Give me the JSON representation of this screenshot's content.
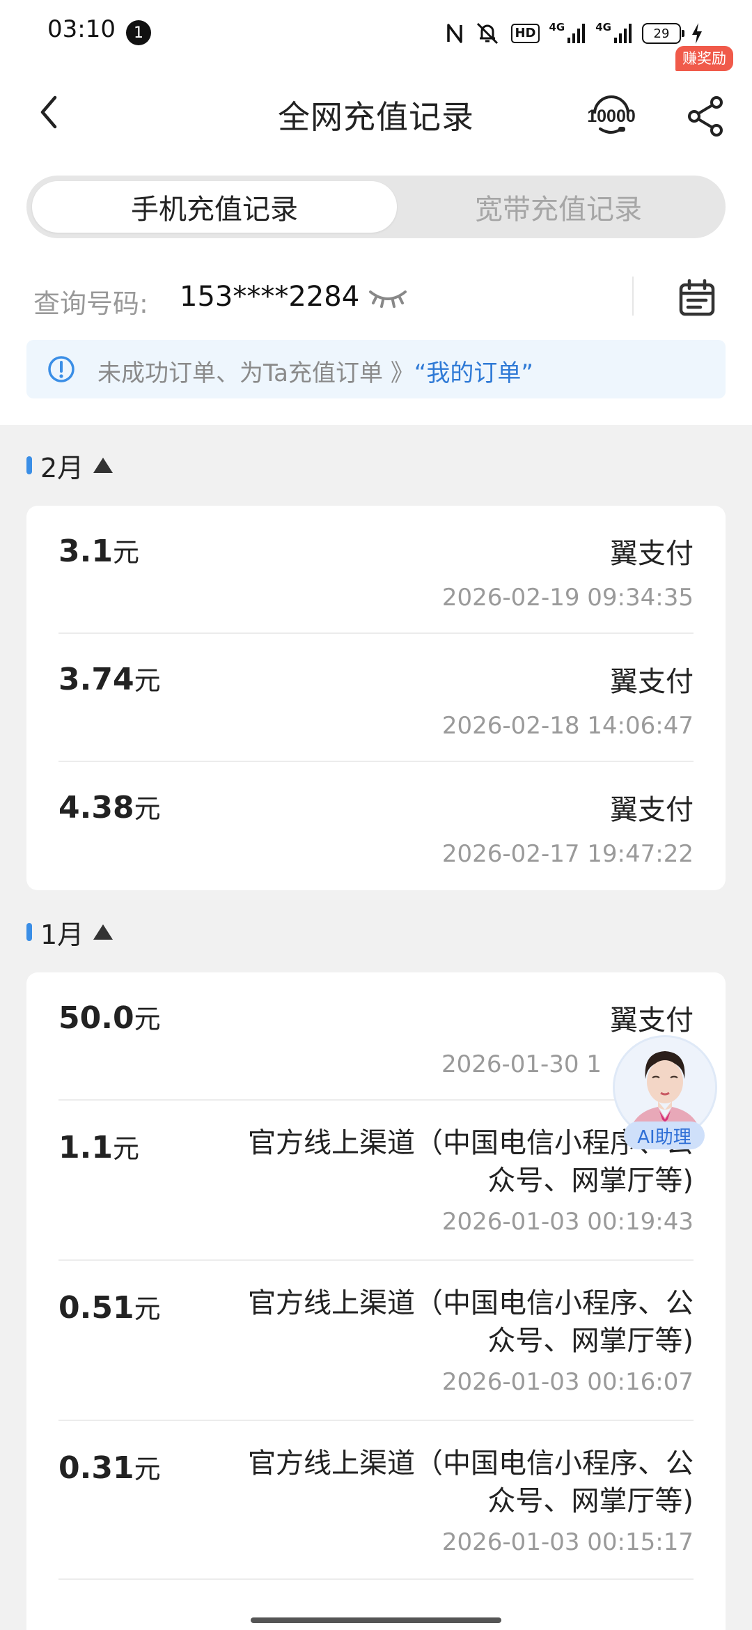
{
  "status_bar": {
    "time": "03:10",
    "notification_count": "1",
    "hd_label": "HD",
    "net1": "4G",
    "net2": "4G",
    "battery": "29"
  },
  "header": {
    "title": "全网充值记录",
    "reward_badge": "赚奖励"
  },
  "tabs": [
    {
      "label": "手机充值记录",
      "active": true
    },
    {
      "label": "宽带充值记录",
      "active": false
    }
  ],
  "query": {
    "label": "查询号码:",
    "number": "153****2284"
  },
  "notice": {
    "text": "未成功订单、为Ta充值订单 》",
    "link": "“我的订单”"
  },
  "months": [
    {
      "label": "2月",
      "records": [
        {
          "amount": "3.1",
          "unit": "元",
          "method": "翼支付",
          "time": "2026-02-19 09:34:35"
        },
        {
          "amount": "3.74",
          "unit": "元",
          "method": "翼支付",
          "time": "2026-02-18 14:06:47"
        },
        {
          "amount": "4.38",
          "unit": "元",
          "method": "翼支付",
          "time": "2026-02-17 19:47:22"
        }
      ]
    },
    {
      "label": "1月",
      "records": [
        {
          "amount": "50.0",
          "unit": "元",
          "method": "翼支付",
          "time": "2026-01-30 1"
        },
        {
          "amount": "1.1",
          "unit": "元",
          "method": "官方线上渠道（中国电信小程序、公众号、网掌厅等)",
          "time": "2026-01-03 00:19:43"
        },
        {
          "amount": "0.51",
          "unit": "元",
          "method": "官方线上渠道（中国电信小程序、公众号、网掌厅等)",
          "time": "2026-01-03 00:16:07"
        },
        {
          "amount": "0.31",
          "unit": "元",
          "method": "官方线上渠道（中国电信小程序、公众号、网掌厅等)",
          "time": "2026-01-03 00:15:17"
        }
      ]
    }
  ],
  "ai_assistant": {
    "label": "AI助理"
  },
  "colors": {
    "accent_blue": "#3a8ee6",
    "link_blue": "#2f7ad6",
    "reward_red": "#f05a4a"
  }
}
